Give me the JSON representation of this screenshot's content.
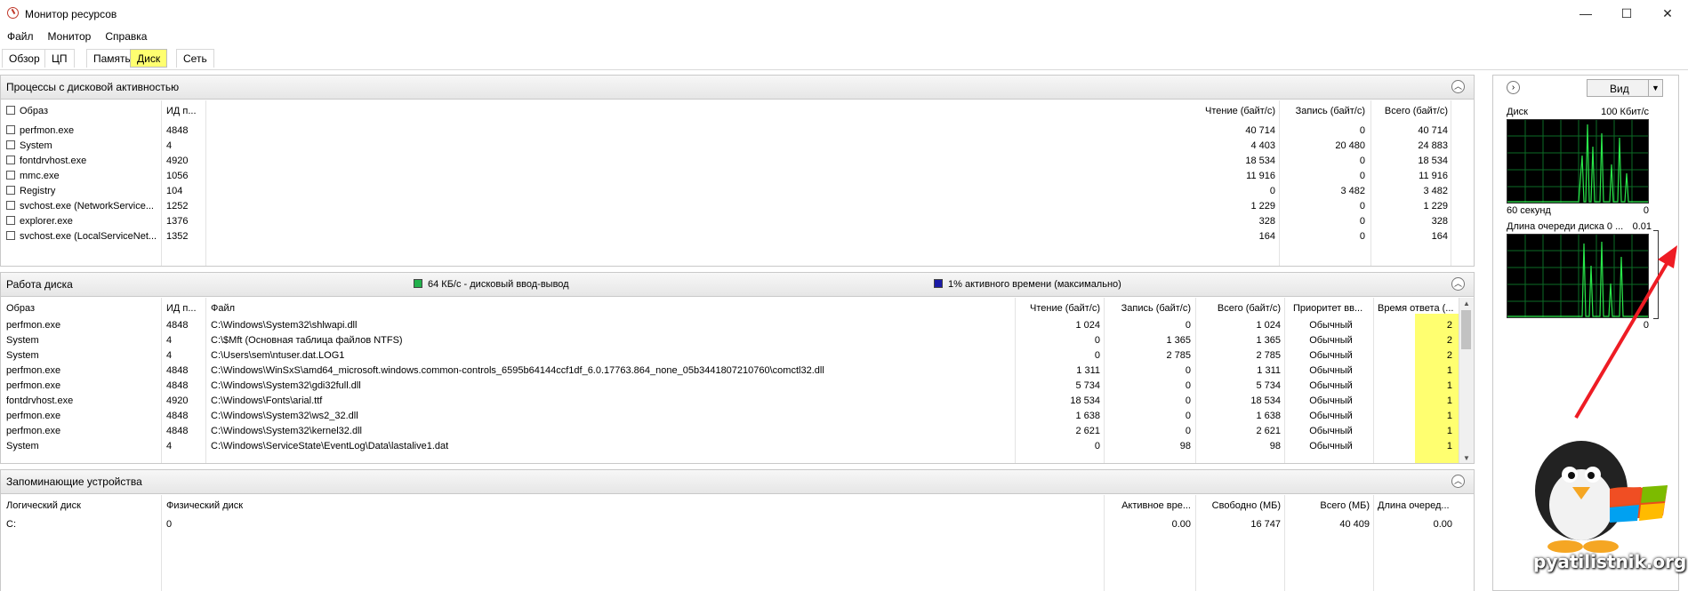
{
  "window": {
    "title": "Монитор ресурсов",
    "minimize": "—",
    "maximize": "☐",
    "close": "✕"
  },
  "menu": [
    "Файл",
    "Монитор",
    "Справка"
  ],
  "tabs": [
    "Обзор",
    "ЦП",
    "Память",
    "Диск",
    "Сеть"
  ],
  "processes": {
    "title": "Процессы с дисковой активностью",
    "headers": {
      "image": "Образ",
      "pid": "ИД п...",
      "read": "Чтение (байт/с)",
      "write": "Запись (байт/с)",
      "total": "Всего (байт/с)"
    },
    "rows": [
      {
        "image": "perfmon.exe",
        "pid": "4848",
        "read": "40 714",
        "write": "0",
        "total": "40 714"
      },
      {
        "image": "System",
        "pid": "4",
        "read": "4 403",
        "write": "20 480",
        "total": "24 883"
      },
      {
        "image": "fontdrvhost.exe",
        "pid": "4920",
        "read": "18 534",
        "write": "0",
        "total": "18 534"
      },
      {
        "image": "mmc.exe",
        "pid": "1056",
        "read": "11 916",
        "write": "0",
        "total": "11 916"
      },
      {
        "image": "Registry",
        "pid": "104",
        "read": "0",
        "write": "3 482",
        "total": "3 482"
      },
      {
        "image": "svchost.exe (NetworkService...",
        "pid": "1252",
        "read": "1 229",
        "write": "0",
        "total": "1 229"
      },
      {
        "image": "explorer.exe",
        "pid": "1376",
        "read": "328",
        "write": "0",
        "total": "328"
      },
      {
        "image": "svchost.exe (LocalServiceNet...",
        "pid": "1352",
        "read": "164",
        "write": "0",
        "total": "164"
      }
    ]
  },
  "disk": {
    "title": "Работа диска",
    "legend_io": "64 КБ/с - дисковый ввод-вывод",
    "legend_active": "1% активного времени (максимально)",
    "color_io": "#22b14c",
    "color_active": "#1a1aa6",
    "headers": {
      "image": "Образ",
      "pid": "ИД п...",
      "file": "Файл",
      "read": "Чтение (байт/с)",
      "write": "Запись (байт/с)",
      "total": "Всего (байт/с)",
      "priority": "Приоритет вв...",
      "response": "Время ответа (..."
    },
    "rows": [
      {
        "image": "perfmon.exe",
        "pid": "4848",
        "file": "C:\\Windows\\System32\\shlwapi.dll",
        "read": "1 024",
        "write": "0",
        "total": "1 024",
        "priority": "Обычный",
        "response": "2"
      },
      {
        "image": "System",
        "pid": "4",
        "file": "C:\\$Mft (Основная таблица файлов NTFS)",
        "read": "0",
        "write": "1 365",
        "total": "1 365",
        "priority": "Обычный",
        "response": "2"
      },
      {
        "image": "System",
        "pid": "4",
        "file": "C:\\Users\\sem\\ntuser.dat.LOG1",
        "read": "0",
        "write": "2 785",
        "total": "2 785",
        "priority": "Обычный",
        "response": "2"
      },
      {
        "image": "perfmon.exe",
        "pid": "4848",
        "file": "C:\\Windows\\WinSxS\\amd64_microsoft.windows.common-controls_6595b64144ccf1df_6.0.17763.864_none_05b3441807210760\\comctl32.dll",
        "read": "1 311",
        "write": "0",
        "total": "1 311",
        "priority": "Обычный",
        "response": "1"
      },
      {
        "image": "perfmon.exe",
        "pid": "4848",
        "file": "C:\\Windows\\System32\\gdi32full.dll",
        "read": "5 734",
        "write": "0",
        "total": "5 734",
        "priority": "Обычный",
        "response": "1"
      },
      {
        "image": "fontdrvhost.exe",
        "pid": "4920",
        "file": "C:\\Windows\\Fonts\\arial.ttf",
        "read": "18 534",
        "write": "0",
        "total": "18 534",
        "priority": "Обычный",
        "response": "1"
      },
      {
        "image": "perfmon.exe",
        "pid": "4848",
        "file": "C:\\Windows\\System32\\ws2_32.dll",
        "read": "1 638",
        "write": "0",
        "total": "1 638",
        "priority": "Обычный",
        "response": "1"
      },
      {
        "image": "perfmon.exe",
        "pid": "4848",
        "file": "C:\\Windows\\System32\\kernel32.dll",
        "read": "2 621",
        "write": "0",
        "total": "2 621",
        "priority": "Обычный",
        "response": "1"
      },
      {
        "image": "System",
        "pid": "4",
        "file": "C:\\Windows\\ServiceState\\EventLog\\Data\\lastalive1.dat",
        "read": "0",
        "write": "98",
        "total": "98",
        "priority": "Обычный",
        "response": "1"
      }
    ]
  },
  "storage": {
    "title": "Запоминающие устройства",
    "headers": {
      "logical": "Логический диск",
      "physical": "Физический диск",
      "active": "Активное вре...",
      "free": "Свободно (МБ)",
      "total": "Всего (МБ)",
      "queue": "Длина очеред..."
    },
    "rows": [
      {
        "logical": "C:",
        "physical": "0",
        "active": "0.00",
        "free": "16 747",
        "total": "40 409",
        "queue": "0.00"
      }
    ]
  },
  "sidepanel": {
    "view_label": "Вид",
    "disk_label": "Диск",
    "disk_scale": "100 Кбит/с",
    "time_label": "60 секунд",
    "disk_min": "0",
    "queue_label": "Длина очереди диска 0 ...",
    "queue_max": "0.01",
    "queue_min": "0"
  },
  "watermark": {
    "text": "pyatilistnik.org"
  }
}
